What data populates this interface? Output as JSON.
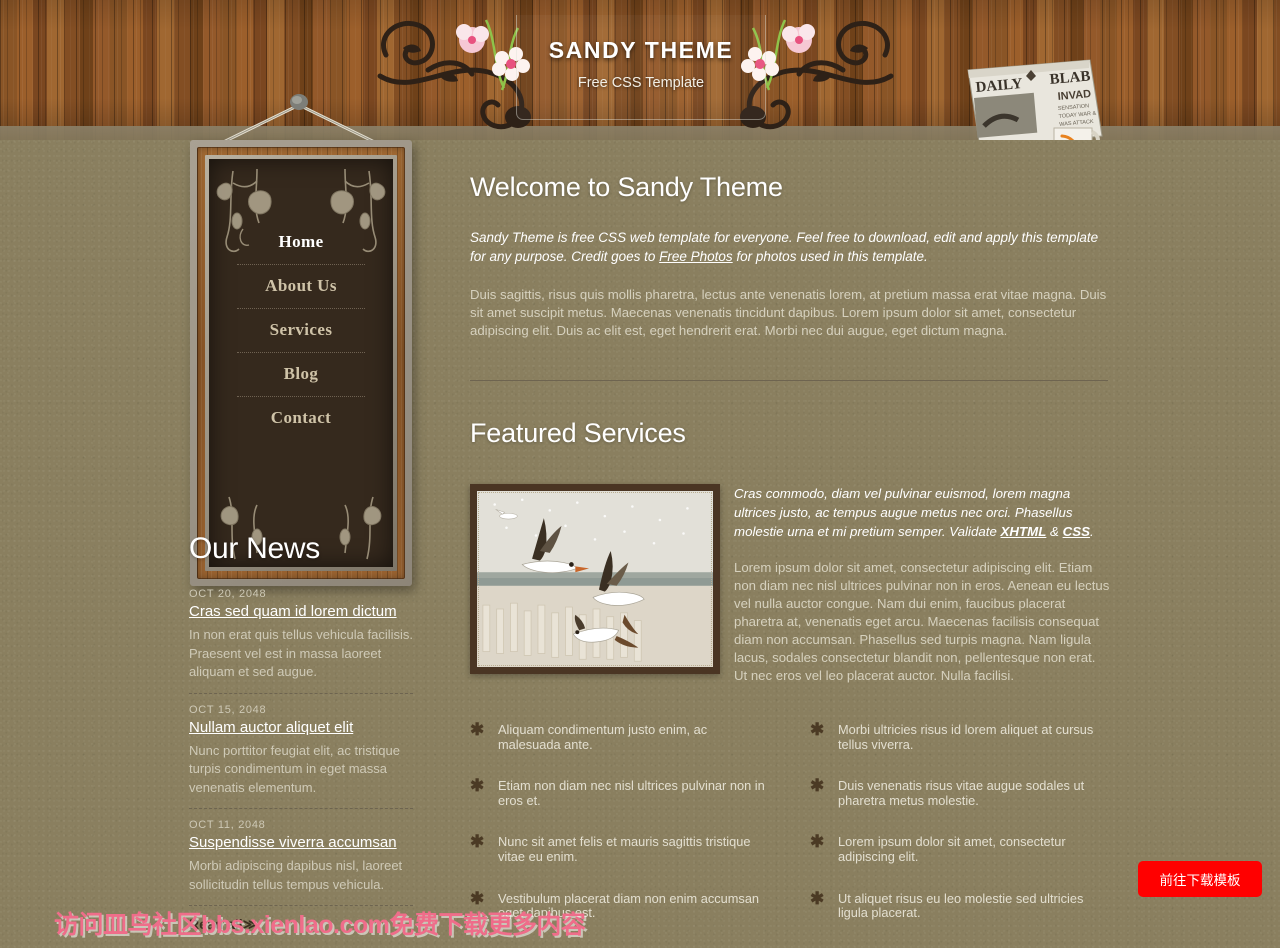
{
  "header": {
    "title": "SANDY THEME",
    "slogan": "Free CSS Template",
    "newspaper": {
      "masthead": "DAILY BLAB",
      "headline": "INVAD",
      "subhead": "SENSATION TODAY WAR & WAS ATTACK"
    }
  },
  "nav": {
    "items": [
      {
        "label": "Home",
        "active": true
      },
      {
        "label": "About Us",
        "active": false
      },
      {
        "label": "Services",
        "active": false
      },
      {
        "label": "Blog",
        "active": false
      },
      {
        "label": "Contact",
        "active": false
      }
    ]
  },
  "news": {
    "title": "Our News",
    "items": [
      {
        "date": "OCT 20, 2048",
        "headline": "Cras sed quam id lorem dictum",
        "text": "In non erat quis tellus vehicula facilisis. Praesent vel est in massa laoreet aliquam et sed augue."
      },
      {
        "date": "OCT 15, 2048",
        "headline": "Nullam auctor aliquet elit",
        "text": "Nunc porttitor feugiat elit, ac tristique turpis condimentum in eget massa venenatis elementum."
      },
      {
        "date": "OCT 11, 2048",
        "headline": "Suspendisse viverra accumsan",
        "text": "Morbi adipiscing dapibus nisl, laoreet sollicitudin tellus tempus vehicula."
      }
    ],
    "read_all": "Read all≫"
  },
  "welcome": {
    "title": "Welcome to Sandy Theme",
    "intro_before": "Sandy Theme is free CSS web template for everyone. Feel free to download, edit and apply this template for any purpose. Credit goes to ",
    "intro_link": "Free Photos",
    "intro_after": " for photos used in this template.",
    "paragraph": "Duis sagittis, risus quis mollis pharetra, lectus ante venenatis lorem, at pretium massa erat vitae magna. Duis sit amet suscipit metus. Maecenas venenatis tincidunt dapibus. Lorem ipsum dolor sit amet, consectetur adipiscing elit. Duis ac elit est, eget hendrerit erat. Morbi nec dui augue, eget dictum magna."
  },
  "services": {
    "title": "Featured Services",
    "photo_alt": "seagulls-flying-over-pier",
    "em_before": "Cras commodo, diam vel pulvinar euismod, lorem magna ultrices justo, ac tempus augue metus nec orci. Phasellus molestie urna et mi pretium semper. Validate ",
    "em_link1": "XHTML",
    "em_mid": " & ",
    "em_link2": "CSS",
    "em_after": ".",
    "body": "Lorem ipsum dolor sit amet, consectetur adipiscing elit. Etiam non diam nec nisl ultrices pulvinar non in eros. Aenean eu lectus vel nulla auctor congue. Nam dui enim, faucibus placerat pharetra at, venenatis eget arcu. Maecenas facilisis consequat diam non accumsan. Phasellus sed turpis magna. Nam ligula lacus, sodales consectetur blandit non, pellentesque non erat. Ut nec eros vel leo placerat auctor. Nulla facilisi.",
    "bullets_left": [
      "Aliquam condimentum justo enim, ac malesuada ante.",
      "Etiam non diam nec nisl ultrices pulvinar non in eros et.",
      "Nunc sit amet felis et mauris sagittis tristique vitae eu enim.",
      "Vestibulum placerat diam non enim accumsan eget dapibus est."
    ],
    "bullets_right": [
      "Morbi ultricies risus id lorem aliquet at cursus tellus viverra.",
      "Duis venenatis risus vitae augue sodales ut pharetra metus molestie.",
      "Lorem ipsum dolor sit amet, consectetur adipiscing elit.",
      "Ut aliquet risus eu leo molestie sed ultricies ligula placerat."
    ],
    "bullet_glyph": "✱"
  },
  "overlay": {
    "watermark": "访问皿鸟社区bbs.xienlao.com免费下载更多内容",
    "download_button": "前往下载模板"
  },
  "colors": {
    "page_bg": "#8a7f5f",
    "wood": "#8b5a2b",
    "board": "#35291d",
    "accent_text": "#ffffff",
    "watermark": "#ef6d8a",
    "button_red": "#ff0000"
  }
}
